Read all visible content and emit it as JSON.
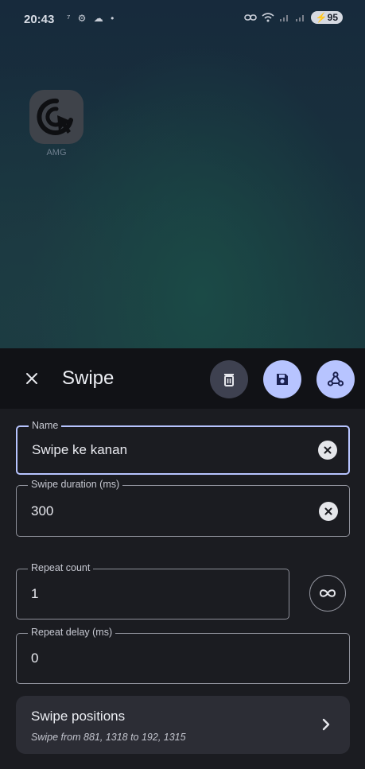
{
  "status_bar": {
    "time": "20:43",
    "left_icons": "⁷ ⚙ ☁ •",
    "battery": "95"
  },
  "home": {
    "app_label": "AMG"
  },
  "toolbar": {
    "title": "Swipe"
  },
  "fields": {
    "name": {
      "label": "Name",
      "value": "Swipe ke kanan"
    },
    "duration": {
      "label": "Swipe duration (ms)",
      "value": "300"
    },
    "repeat_count": {
      "label": "Repeat count",
      "value": "1"
    },
    "repeat_delay": {
      "label": "Repeat delay (ms)",
      "value": "0"
    }
  },
  "positions": {
    "title": "Swipe positions",
    "subtitle": "Swipe from 881, 1318 to 192, 1315"
  },
  "colors": {
    "accent": "#b7c4ff",
    "sheet_bg": "#1b1c21",
    "toolbar_bg": "#111216"
  },
  "icons": {
    "close": "close-icon",
    "delete": "trash-icon",
    "save": "save-icon",
    "webhook": "webhook-icon",
    "clear": "clear-circle-icon",
    "infinite": "infinity-icon",
    "chevron": "chevron-right-icon"
  }
}
